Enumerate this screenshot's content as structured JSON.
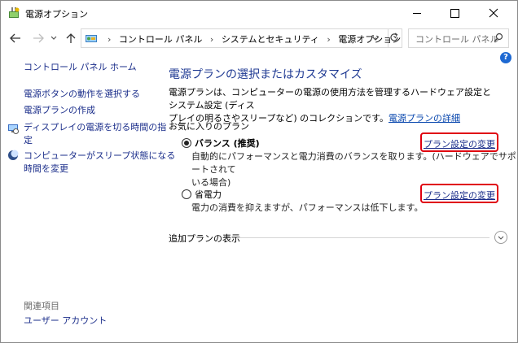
{
  "window": {
    "title": "電源オプション"
  },
  "address": {
    "crumbs": [
      "コントロール パネル",
      "システムとセキュリティ",
      "電源オプション"
    ],
    "search_placeholder": "コントロール パネル"
  },
  "sidebar": {
    "home": "コントロール パネル ホーム",
    "links": [
      "電源ボタンの動作を選択する",
      "電源プランの作成"
    ],
    "icon_links": [
      {
        "line1": "ディスプレイの電源を切る時間の指",
        "line2": "定",
        "icon": "display-schedule-icon"
      },
      {
        "line1": "コンピューターがスリープ状態になる",
        "line2": "時間を変更",
        "icon": "sleep-moon-icon"
      }
    ],
    "related_header": "関連項目",
    "related_links": [
      "ユーザー アカウント"
    ]
  },
  "main": {
    "heading": "電源プランの選択またはカスタマイズ",
    "desc_line1": "電源プランは、コンピューターの電源の使用方法を管理するハードウェア設定とシステム設定 (ディス",
    "desc_line2": "プレイの明るさやスリープなど) のコレクションです。",
    "desc_link": "電源プランの詳細",
    "favorites_label": "お気に入りのプラン",
    "plans": [
      {
        "name": "バランス (推奨)",
        "selected": true,
        "desc_line1": "自動的にパフォーマンスと電力消費のバランスを取ります。(ハードウェアでサポートされて",
        "desc_line2": "いる場合)",
        "change_label": "プラン設定の変更"
      },
      {
        "name": "省電力",
        "selected": false,
        "desc_line1": "電力の消費を抑えますが、パフォーマンスは低下します。",
        "desc_line2": "",
        "change_label": "プラン設定の変更"
      }
    ],
    "more_plans_label": "追加プランの表示"
  },
  "help": {
    "label": "?"
  },
  "colors": {
    "heading": "#1f3a93",
    "link": "#1a2d8a",
    "highlight_border": "#e0000f",
    "help_badge": "#1e69d2"
  }
}
